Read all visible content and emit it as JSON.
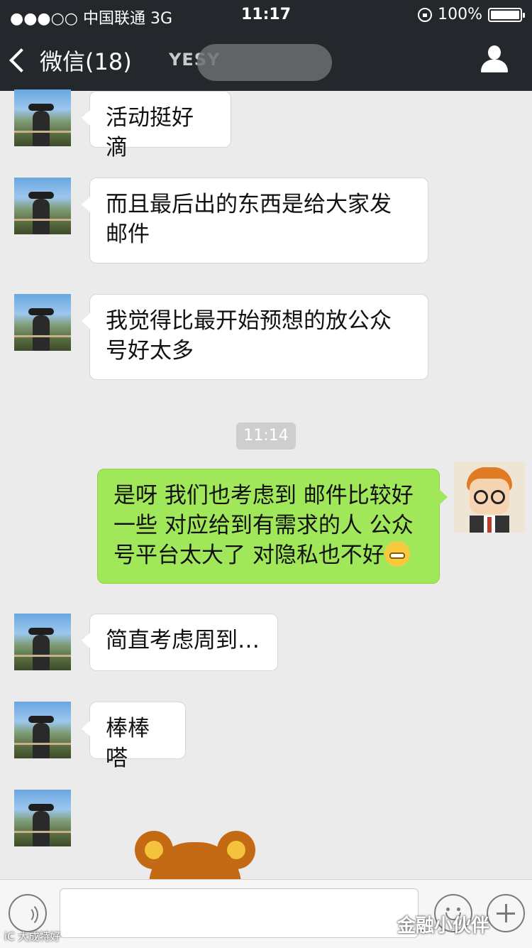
{
  "status_bar": {
    "carrier": "●●●○○ 中国联通  3G",
    "time": "11:17",
    "battery": "100%",
    "battery_level": 100
  },
  "nav": {
    "back_label": "微信(18)",
    "title_redacted": "YESY",
    "profile_icon": "person-icon"
  },
  "messages": [
    {
      "side": "left",
      "text": "活动挺好滴"
    },
    {
      "side": "left",
      "text": "而且最后出的东西是给大家发邮件"
    },
    {
      "side": "left",
      "text": "我觉得比最开始预想的放公众号好太多"
    },
    {
      "type": "time",
      "text": "11:14"
    },
    {
      "side": "right",
      "text": "是呀 我们也考虑到 邮件比较好一些 对应给到有需求的人 公众号平台太大了 对隐私也不好",
      "emoji": "grin-emoji"
    },
    {
      "side": "left",
      "text": "简直考虑周到…"
    },
    {
      "side": "left",
      "text": "棒棒嗒"
    },
    {
      "side": "left",
      "sticker": "bear-sticker"
    }
  ],
  "watermarks": {
    "right": "金融小伙伴",
    "left": "iC 大成特好"
  },
  "colors": {
    "nav_bg": "#24272b",
    "chat_bg": "#ebebeb",
    "my_bubble": "#a0e75a",
    "their_bubble": "#ffffff"
  }
}
